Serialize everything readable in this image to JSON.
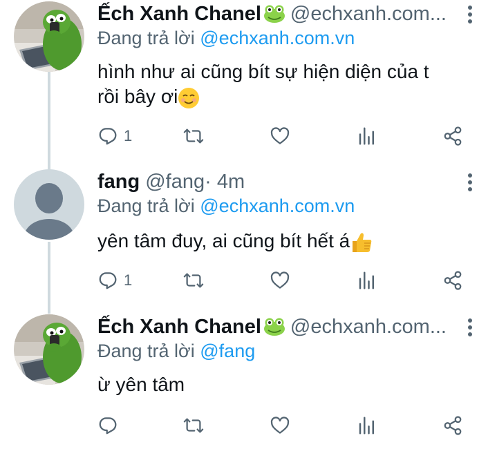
{
  "colors": {
    "link": "#1d9bf0",
    "muted": "#536471",
    "text": "#0f1419",
    "thread": "#cfd9de"
  },
  "tweets": [
    {
      "name": "Ếch Xanh Chanel",
      "name_emoji": "frog-emoji",
      "handle": "@echxanh.com...",
      "time": "",
      "replying_prefix": "Đang trả lời ",
      "replying_to": "@echxanh.com.vn",
      "text_lines": [
        "hình như ai cũng bít sự hiện diện của t",
        "rồi bây ơi"
      ],
      "text_emoji": "smiling-face-emoji",
      "reply_count": "1",
      "avatar": "kermit-avatar"
    },
    {
      "name": "fang",
      "name_emoji": "",
      "handle": "@fang",
      "time": " · 4m",
      "replying_prefix": "Đang trả lời ",
      "replying_to": "@echxanh.com.vn",
      "text_lines": [
        "yên tâm đuy, ai cũng bít hết á"
      ],
      "text_emoji": "thumbs-up-emoji",
      "reply_count": "1",
      "avatar": "default-avatar"
    },
    {
      "name": "Ếch Xanh Chanel",
      "name_emoji": "frog-emoji",
      "handle": "@echxanh.com...",
      "time": "",
      "replying_prefix": "Đang trả lời ",
      "replying_to": "@fang",
      "text_lines": [
        "ừ yên tâm"
      ],
      "text_emoji": "",
      "reply_count": "",
      "avatar": "kermit-avatar"
    }
  ],
  "action_icons": [
    "reply-icon",
    "retweet-icon",
    "like-icon",
    "analytics-icon",
    "share-icon"
  ]
}
